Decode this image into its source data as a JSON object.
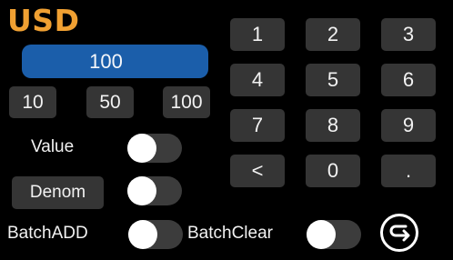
{
  "currency": "USD",
  "amount": "100",
  "presets": [
    "10",
    "50",
    "100"
  ],
  "keypad": [
    "1",
    "2",
    "3",
    "4",
    "5",
    "6",
    "7",
    "8",
    "9",
    "<",
    "0",
    "."
  ],
  "options": {
    "value_label": "Value",
    "value_on": false,
    "denom_label": "Denom",
    "denom_on": false,
    "batch_add_label": "BatchADD",
    "batch_add_on": false,
    "batch_clear_label": "BatchClear",
    "batch_clear_on": false
  },
  "colors": {
    "accent": "#f0a032",
    "display": "#1b5eaa",
    "button": "#353535",
    "toggle_track": "#3c3c3c",
    "toggle_knob": "#ffffff",
    "background": "#000000"
  },
  "icons": {
    "return": "return-arrow-icon"
  }
}
